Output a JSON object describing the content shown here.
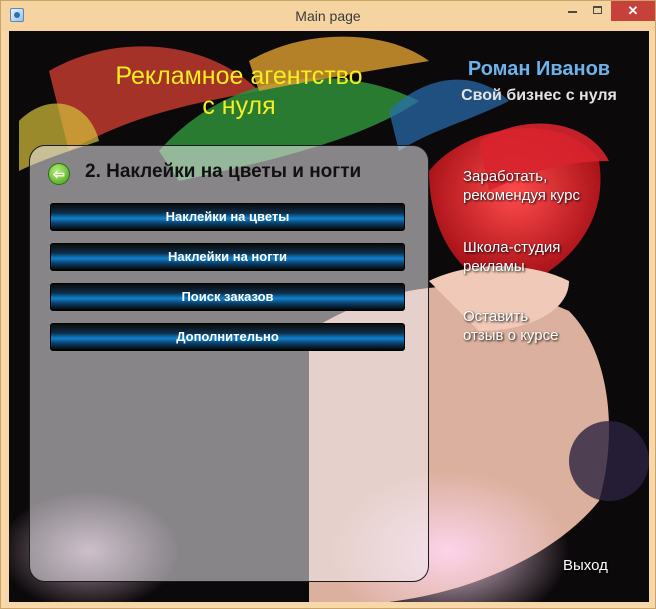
{
  "window": {
    "title": "Main page",
    "close_glyph": "✕"
  },
  "header": {
    "title_line1": "Рекламное агентство",
    "title_line2": "с нуля",
    "author": "Роман Иванов",
    "tagline": "Свой бизнес с нуля"
  },
  "panel": {
    "back_glyph": "⇦",
    "title": "2. Наклейки на цветы и ногти",
    "buttons": [
      {
        "label": "Наклейки на цветы"
      },
      {
        "label": "Наклейки на ногти"
      },
      {
        "label": "Поиск заказов"
      },
      {
        "label": "Дополнительно"
      }
    ]
  },
  "side_links": [
    {
      "line1": "Заработать,",
      "line2": "рекомендуя курс"
    },
    {
      "line1": "Школа-студия",
      "line2": "рекламы"
    },
    {
      "line1": "Оставить",
      "line2": "отзыв о курсе"
    }
  ],
  "exit_label": "Выход",
  "colors": {
    "heading": "#f5ef1f",
    "author": "#6db2ea",
    "button_glow": "#0f82cf"
  }
}
